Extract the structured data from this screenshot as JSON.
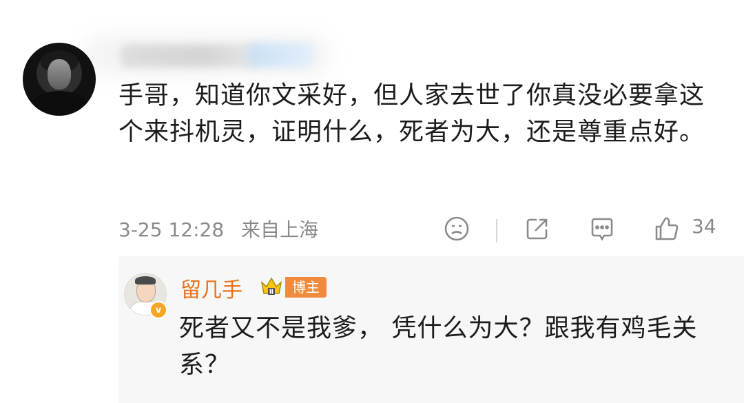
{
  "comment": {
    "text": "手哥，知道你文采好，但人家去世了你真没必要拿这个来抖机灵，证明什么，死者为大，还是尊重点好。",
    "date": "3-25 12:28",
    "location": "来自上海",
    "like_count": "34",
    "icons": [
      "emoji-icon",
      "share-icon",
      "comment-icon",
      "like-icon"
    ]
  },
  "reply": {
    "author": "留几手",
    "badge": "博主",
    "verified_mark": "v",
    "text": "死者又不是我爹， 凭什么为大？跟我有鸡毛关系？",
    "author_color": "#e8721c",
    "badge_color": "#f08a3c"
  }
}
